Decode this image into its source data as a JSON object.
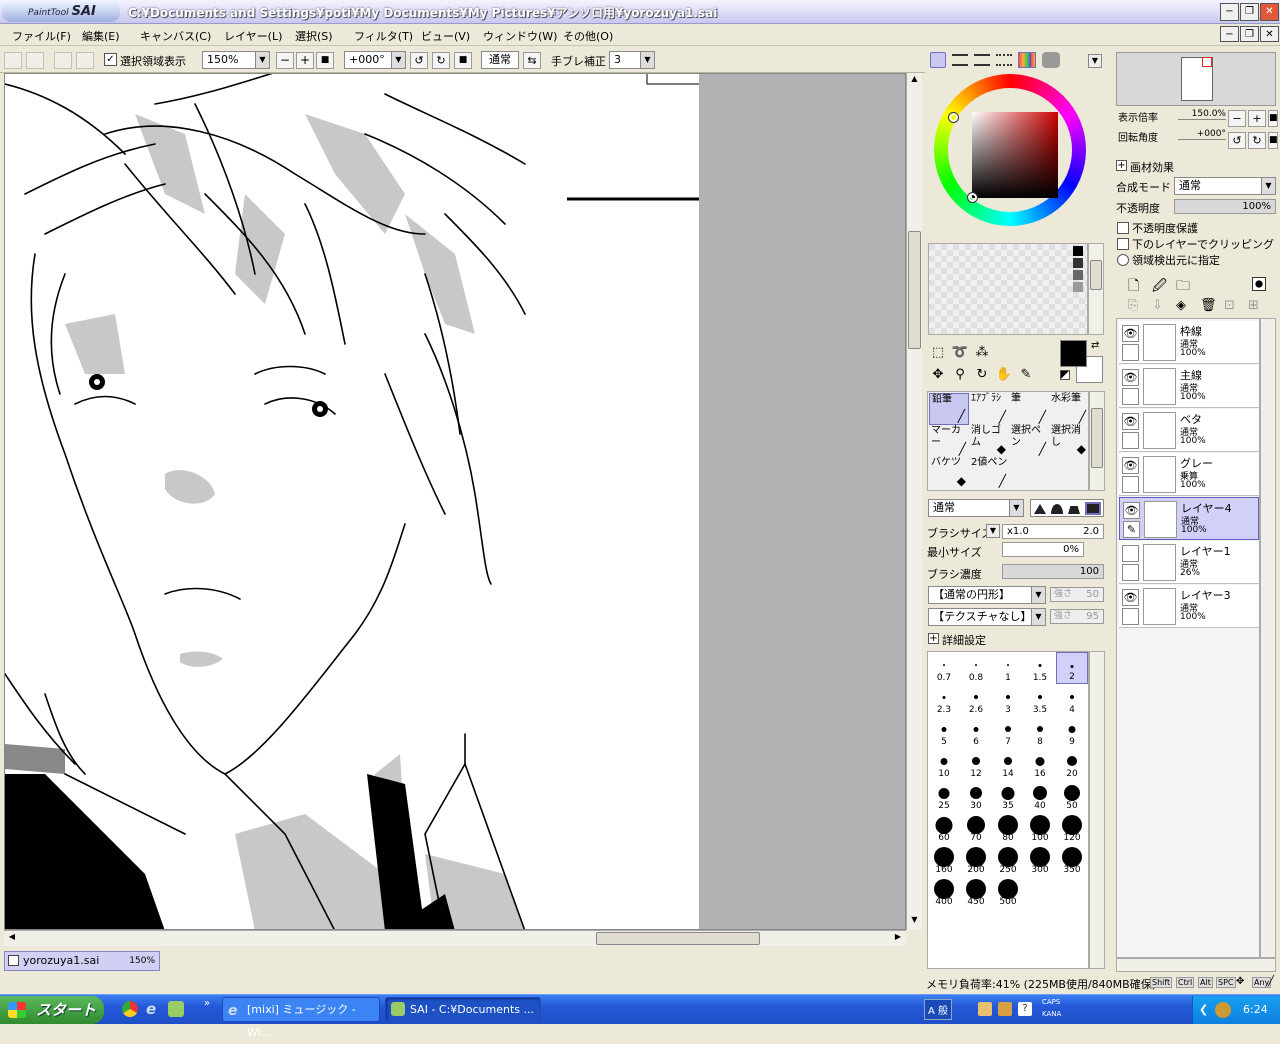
{
  "window": {
    "app_logo_small": "PaintTool",
    "app_logo": "SAI",
    "title_path": "C:¥Documents and Settings¥poti¥My Documents¥My Pictures¥アンソロ用¥yorozuya1.sai",
    "controls": [
      "−",
      "❐",
      "✕"
    ]
  },
  "menu": [
    "ファイル(F)",
    "編集(E)",
    "キャンバス(C)",
    "レイヤー(L)",
    "選択(S)",
    "フィルタ(T)",
    "ビュー(V)",
    "ウィンドウ(W)",
    "その他(O)"
  ],
  "toolbar": {
    "show_selection_label": "選択領域表示",
    "zoom_value": "150%",
    "rotation_value": "+000°",
    "mode_label": "通常",
    "stabilizer_label": "手ブレ補正",
    "stabilizer_value": "3"
  },
  "document_tab": {
    "name": "yorozuya1.sai",
    "zoom": "150%"
  },
  "navigator": {
    "zoom_label": "表示倍率",
    "zoom_value": "150.0%",
    "rotation_label": "回転角度",
    "rotation_value": "+000°"
  },
  "layer_props": {
    "texture_label": "画材効果",
    "blend_label": "合成モード",
    "blend_value": "通常",
    "opacity_label": "不透明度",
    "opacity_value": "100%",
    "preserve_opacity": "不透明度保護",
    "clip_label": "下のレイヤーでクリッピング",
    "detect_label": "領域検出元に指定"
  },
  "layers": [
    {
      "name": "枠線",
      "mode": "通常",
      "opacity": "100%",
      "visible": true,
      "selected": false
    },
    {
      "name": "主線",
      "mode": "通常",
      "opacity": "100%",
      "visible": true,
      "selected": false
    },
    {
      "name": "ベタ",
      "mode": "通常",
      "opacity": "100%",
      "visible": true,
      "selected": false
    },
    {
      "name": "グレー",
      "mode": "乗算",
      "opacity": "100%",
      "visible": true,
      "selected": false
    },
    {
      "name": "レイヤー4",
      "mode": "通常",
      "opacity": "100%",
      "visible": true,
      "selected": true
    },
    {
      "name": "レイヤー1",
      "mode": "通常",
      "opacity": "26%",
      "visible": false,
      "selected": false
    },
    {
      "name": "レイヤー3",
      "mode": "通常",
      "opacity": "100%",
      "visible": true,
      "selected": false
    }
  ],
  "tools": [
    {
      "label": "鉛筆",
      "selected": true
    },
    {
      "label": "ｴｱﾌﾞﾗｼ",
      "selected": false
    },
    {
      "label": "筆",
      "selected": false
    },
    {
      "label": "水彩筆",
      "selected": false
    },
    {
      "label": "マーカー",
      "selected": false
    },
    {
      "label": "消しゴム",
      "selected": false
    },
    {
      "label": "選択ペン",
      "selected": false
    },
    {
      "label": "選択消し",
      "selected": false
    },
    {
      "label": "バケツ",
      "selected": false
    },
    {
      "label": "2値ペン",
      "selected": false
    }
  ],
  "brush": {
    "mode": "通常",
    "size_label": "ブラシサイズ",
    "size_mult": "x1.0",
    "size_value": "2.0",
    "min_size_label": "最小サイズ",
    "min_size_value": "0%",
    "density_label": "ブラシ濃度",
    "density_value": "100",
    "shape": "【通常の円形】",
    "shape_strength_label": "強さ",
    "shape_strength": "50",
    "texture": "【テクスチャなし】",
    "texture_strength_label": "強さ",
    "texture_strength": "95",
    "advanced_label": "詳細設定",
    "sizes": [
      "0.7",
      "0.8",
      "1",
      "1.5",
      "2",
      "2.3",
      "2.6",
      "3",
      "3.5",
      "4",
      "5",
      "6",
      "7",
      "8",
      "9",
      "10",
      "12",
      "14",
      "16",
      "20",
      "25",
      "30",
      "35",
      "40",
      "50",
      "60",
      "70",
      "80",
      "100",
      "120",
      "160",
      "200",
      "250",
      "300",
      "350",
      "400",
      "450",
      "500"
    ],
    "selected_size": "2"
  },
  "status": {
    "memory": "メモリ負荷率:41% (225MB使用/840MB確保)",
    "keys": [
      "Shift",
      "Ctrl",
      "Alt",
      "SPC",
      "✥",
      "Any",
      "╱"
    ]
  },
  "taskbar": {
    "start_label": "スタート",
    "tasks": [
      "[mixi] ミュージック - Wi...",
      "SAI - C:¥Documents ..."
    ],
    "tray_ime": "A 般",
    "tray_caps": "CAPS",
    "tray_kana": "KANA",
    "clock": "6:24"
  },
  "colors": {
    "selection_blue": "#c8c8f0",
    "title_gradient_top": "#f4f4ff",
    "taskbar_blue": "#2458d8",
    "start_green": "#2e8b2e",
    "primary_color": "#000000",
    "secondary_color": "#ffffff"
  }
}
